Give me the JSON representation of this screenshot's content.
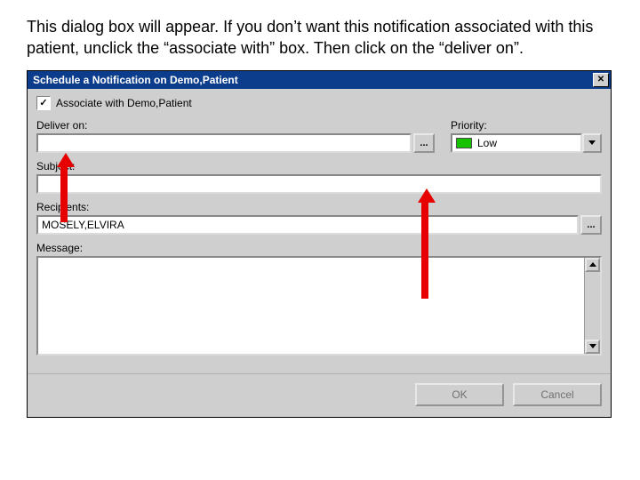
{
  "instruction": "This dialog box will appear. If you don’t want this notification associated with this patient, unclick the “associate with” box. Then click on the “deliver on”.",
  "dialog": {
    "title": "Schedule a Notification on Demo,Patient",
    "close_glyph": "✕",
    "associate": {
      "checked_mark": "✓",
      "label": "Associate with Demo,Patient"
    },
    "deliver": {
      "label": "Deliver on:",
      "value": "",
      "ellipsis": "..."
    },
    "priority": {
      "label": "Priority:",
      "value": "Low"
    },
    "subject": {
      "label": "Subject:",
      "value": ""
    },
    "recipients": {
      "label": "Recipients:",
      "value": "MOSELY,ELVIRA",
      "ellipsis": "..."
    },
    "message": {
      "label": "Message:",
      "value": ""
    },
    "buttons": {
      "ok": "OK",
      "cancel": "Cancel"
    }
  }
}
